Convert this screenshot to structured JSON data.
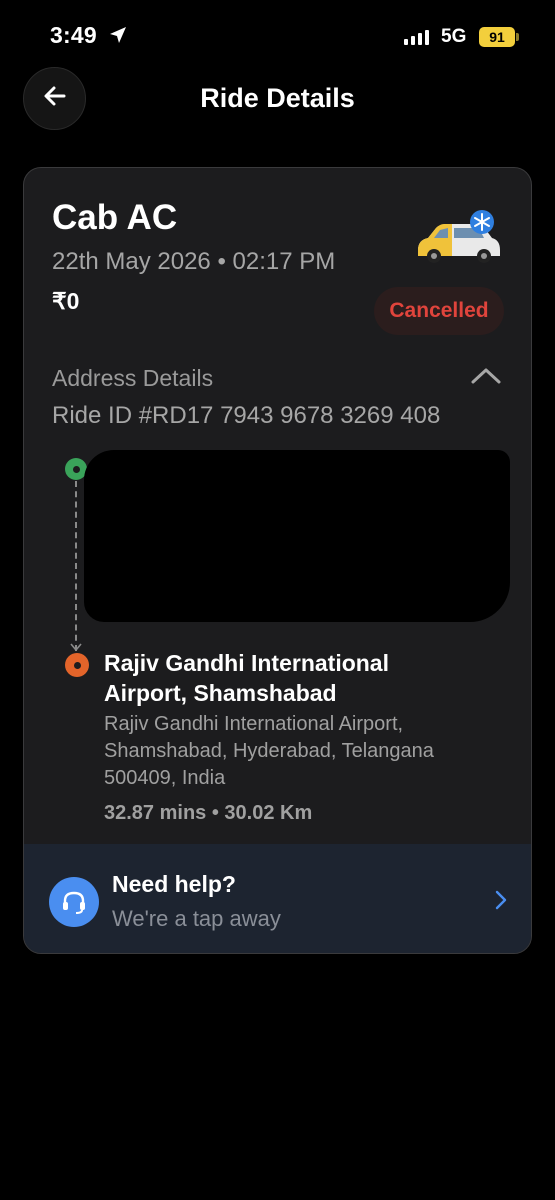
{
  "status_bar": {
    "time": "3:49",
    "network": "5G",
    "battery": "91"
  },
  "header": {
    "title": "Ride Details"
  },
  "ride": {
    "type": "Cab AC",
    "datetime": "22th May 2026 • 02:17 PM",
    "fare": "₹0",
    "status": "Cancelled",
    "status_color": "#e0443c"
  },
  "address": {
    "section_title": "Address Details",
    "ride_id": "Ride ID #RD17 7943 9678 3269 408",
    "drop": {
      "name": "Rajiv Gandhi International Airport, Shamshabad",
      "address": "Rajiv Gandhi International Airport, Shamshabad, Hyderabad, Telangana 500409, India"
    },
    "trip_stats": "32.87 mins • 30.02 Km"
  },
  "help": {
    "title": "Need help?",
    "subtitle": "We're a tap away"
  },
  "colors": {
    "pickup": "#3aa35a",
    "drop": "#e3642a",
    "help_accent": "#4a8ef0"
  }
}
